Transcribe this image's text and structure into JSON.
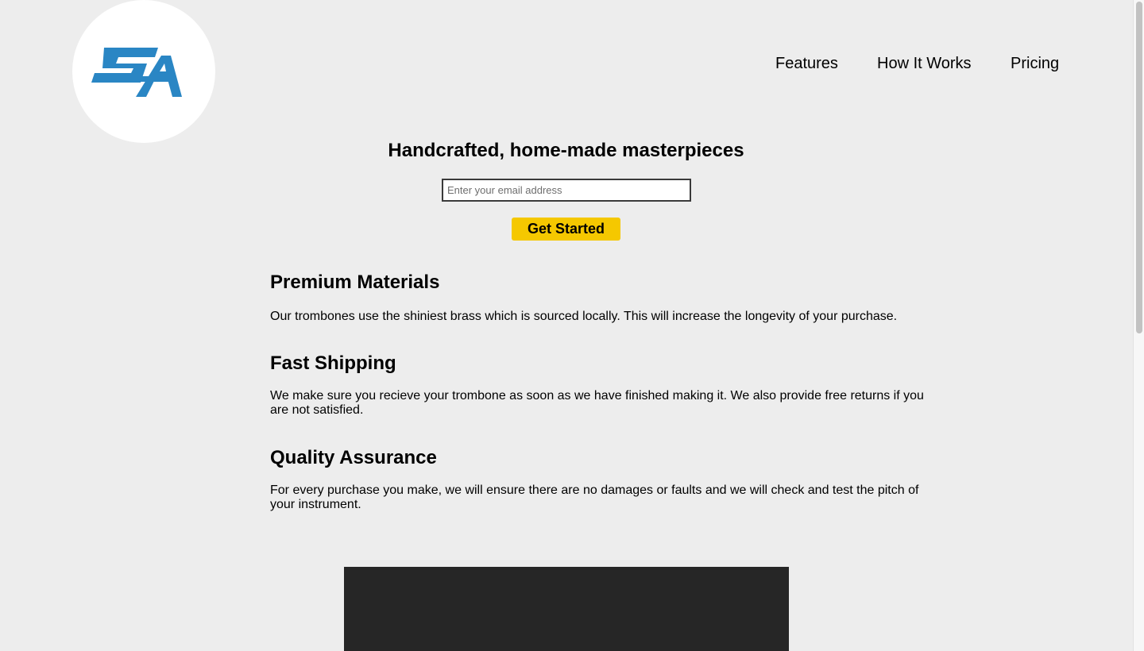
{
  "header": {
    "logo_text": "SA",
    "nav": [
      {
        "label": "Features"
      },
      {
        "label": "How It Works"
      },
      {
        "label": "Pricing"
      }
    ]
  },
  "hero": {
    "title": "Handcrafted, home-made masterpieces",
    "email_placeholder": "Enter your email address",
    "cta_label": "Get Started"
  },
  "features": [
    {
      "title": "Premium Materials",
      "text": "Our trombones use the shiniest brass which is sourced locally. This will increase the longevity of your purchase."
    },
    {
      "title": "Fast Shipping",
      "text": "We make sure you recieve your trombone as soon as we have finished making it. We also provide free returns if you are not satisfied."
    },
    {
      "title": "Quality Assurance",
      "text": "For every purchase you make, we will ensure there are no damages or faults and we will check and test the pitch of your instrument."
    }
  ],
  "colors": {
    "background": "#ededed",
    "cta": "#f5c800",
    "logo_blue": "#2a86c4",
    "video_bg": "#262626"
  }
}
